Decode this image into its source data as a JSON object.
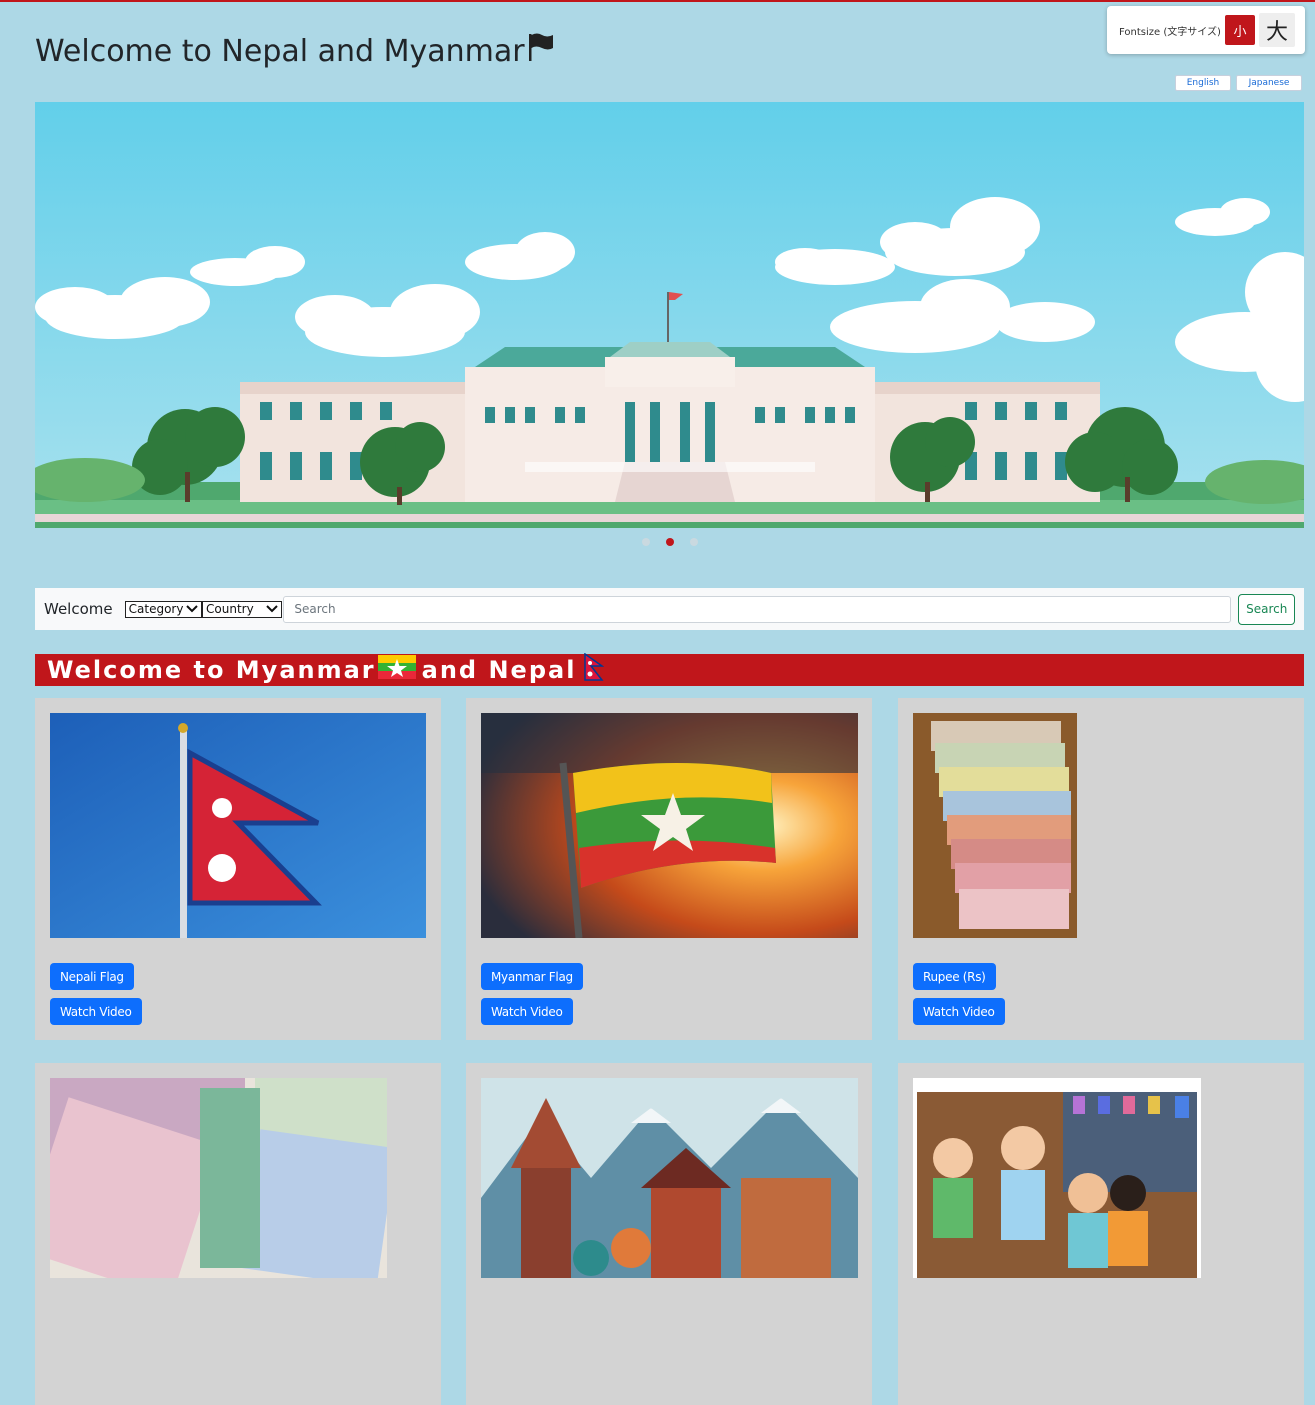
{
  "header": {
    "title": "Welcome to Nepal and Myanmar",
    "title_icon": "flag-icon"
  },
  "fontsize": {
    "label": "Fontsize (文字サイズ)",
    "small": "小",
    "large": "大"
  },
  "languages": [
    "English",
    "Japanese"
  ],
  "carousel": {
    "slide_count": 3,
    "active_index": 1
  },
  "navbar": {
    "brand": "Welcome",
    "category_select": "Category",
    "country_select": "Country",
    "search_placeholder": "Search",
    "search_button": "Search"
  },
  "section": {
    "title_part1": "Welcome to Myanmar",
    "title_part2": "and Nepal"
  },
  "cards": [
    {
      "button1": "Nepali Flag",
      "button2": "Watch Video",
      "image": "nepal-flag-image"
    },
    {
      "button1": "Myanmar Flag",
      "button2": "Watch Video",
      "image": "myanmar-flag-image"
    },
    {
      "button1": "Rupee (Rs)",
      "button2": "Watch Video",
      "image": "rupee-notes-image"
    },
    {
      "image": "kyat-notes-image"
    },
    {
      "image": "nepal-culture-image"
    },
    {
      "image": "myanmar-family-image"
    }
  ],
  "colors": {
    "background": "#add8e6",
    "accent_red": "#c0161b",
    "button_blue": "#0d6efd",
    "card_gray": "#d3d3d3",
    "search_green": "#198754"
  }
}
